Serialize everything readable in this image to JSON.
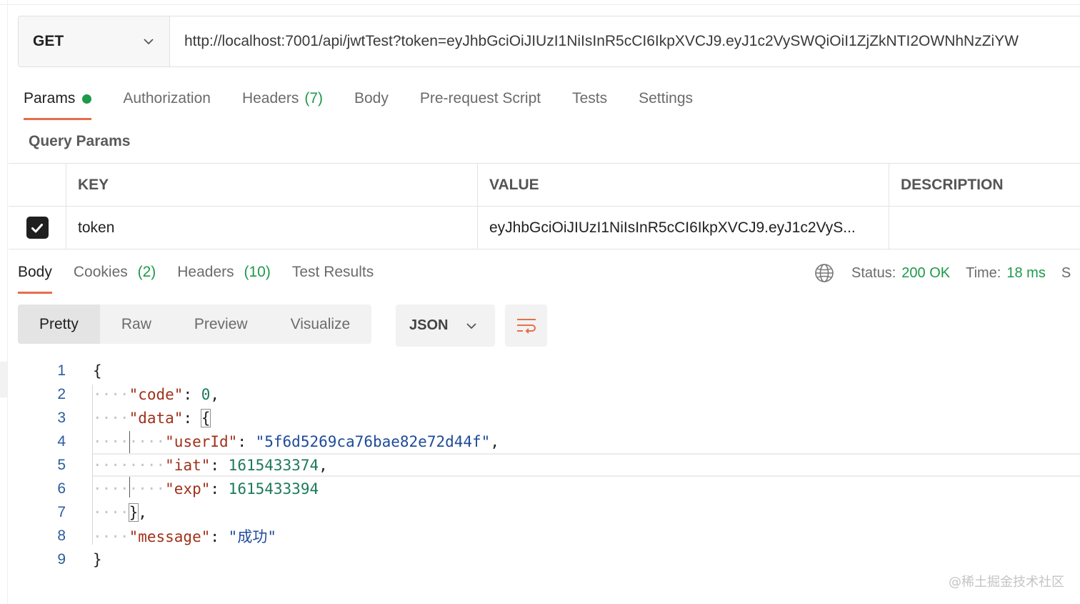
{
  "request": {
    "method": "GET",
    "url": "http://localhost:7001/api/jwtTest?token=eyJhbGciOiJIUzI1NiIsInR5cCI6IkpXVCJ9.eyJ1c2VySWQiOiI1ZjZkNTI2OWNhNzZiYW"
  },
  "request_tabs": [
    {
      "label": "Params",
      "active": true,
      "dot": true
    },
    {
      "label": "Authorization"
    },
    {
      "label": "Headers",
      "count": "(7)"
    },
    {
      "label": "Body"
    },
    {
      "label": "Pre-request Script"
    },
    {
      "label": "Tests"
    },
    {
      "label": "Settings"
    }
  ],
  "query_params": {
    "title": "Query Params",
    "columns": [
      "KEY",
      "VALUE",
      "DESCRIPTION"
    ],
    "rows": [
      {
        "checked": true,
        "key": "token",
        "value": "eyJhbGciOiJIUzI1NiIsInR5cCI6IkpXVCJ9.eyJ1c2VyS...",
        "description": ""
      }
    ]
  },
  "response_tabs": [
    {
      "label": "Body",
      "active": true
    },
    {
      "label": "Cookies",
      "count": "(2)"
    },
    {
      "label": "Headers",
      "count": "(10)"
    },
    {
      "label": "Test Results"
    }
  ],
  "status": {
    "status_label": "Status:",
    "status_value": "200 OK",
    "time_label": "Time:",
    "time_value": "18 ms",
    "size_label_partial": "S"
  },
  "view_modes": [
    "Pretty",
    "Raw",
    "Preview",
    "Visualize"
  ],
  "format": "JSON",
  "code_lines": [
    {
      "n": "1"
    },
    {
      "n": "2"
    },
    {
      "n": "3"
    },
    {
      "n": "4"
    },
    {
      "n": "5"
    },
    {
      "n": "6"
    },
    {
      "n": "7"
    },
    {
      "n": "8"
    },
    {
      "n": "9"
    }
  ],
  "json_body": {
    "open": "{",
    "code_key": "\"code\"",
    "code_val": "0",
    "data_key": "\"data\"",
    "data_open": "{",
    "userId_key": "\"userId\"",
    "userId_val": "\"5f6d5269ca76bae82e72d44f\"",
    "iat_key": "\"iat\"",
    "iat_val": "1615433374",
    "exp_key": "\"exp\"",
    "exp_val": "1615433394",
    "data_close": "}",
    "message_key": "\"message\"",
    "message_val": "\"成功\"",
    "close": "}"
  },
  "watermark": "@稀土掘金技术社区",
  "colors": {
    "accent": "#e56e4d",
    "success": "#1c9a4a",
    "json_key": "#a0311b",
    "json_string": "#1f4b9a",
    "json_number": "#1c7a5a"
  }
}
